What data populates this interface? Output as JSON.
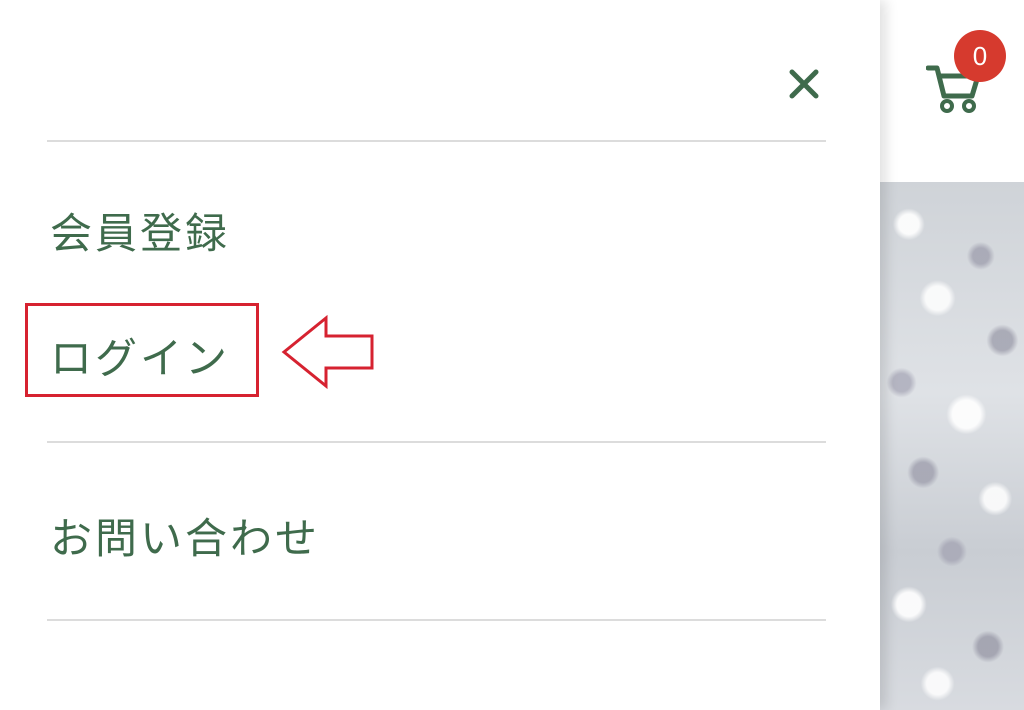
{
  "cart": {
    "count": "0",
    "icon": "cart-icon",
    "badge_color": "#d63a2e"
  },
  "drawer": {
    "close_icon": "close-icon",
    "menu_items": [
      {
        "label": "会員登録"
      },
      {
        "label": "ログイン"
      },
      {
        "label": "お問い合わせ"
      }
    ]
  },
  "annotation": {
    "highlight_color": "#d62230",
    "arrow_icon": "arrow-left-outline-icon"
  },
  "colors": {
    "accent": "#3f6b4c",
    "divider": "#dcdcdc"
  }
}
